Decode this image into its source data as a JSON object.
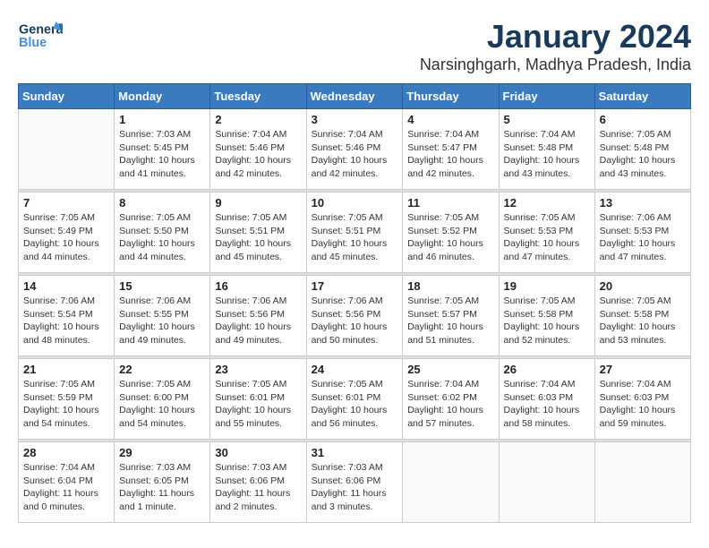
{
  "header": {
    "logo_line1": "General",
    "logo_line2": "Blue",
    "title": "January 2024",
    "subtitle": "Narsinghgarh, Madhya Pradesh, India"
  },
  "days_of_week": [
    "Sunday",
    "Monday",
    "Tuesday",
    "Wednesday",
    "Thursday",
    "Friday",
    "Saturday"
  ],
  "weeks": [
    [
      {
        "day": "",
        "sunrise": "",
        "sunset": "",
        "daylight": ""
      },
      {
        "day": "1",
        "sunrise": "Sunrise: 7:03 AM",
        "sunset": "Sunset: 5:45 PM",
        "daylight": "Daylight: 10 hours and 41 minutes."
      },
      {
        "day": "2",
        "sunrise": "Sunrise: 7:04 AM",
        "sunset": "Sunset: 5:46 PM",
        "daylight": "Daylight: 10 hours and 42 minutes."
      },
      {
        "day": "3",
        "sunrise": "Sunrise: 7:04 AM",
        "sunset": "Sunset: 5:46 PM",
        "daylight": "Daylight: 10 hours and 42 minutes."
      },
      {
        "day": "4",
        "sunrise": "Sunrise: 7:04 AM",
        "sunset": "Sunset: 5:47 PM",
        "daylight": "Daylight: 10 hours and 42 minutes."
      },
      {
        "day": "5",
        "sunrise": "Sunrise: 7:04 AM",
        "sunset": "Sunset: 5:48 PM",
        "daylight": "Daylight: 10 hours and 43 minutes."
      },
      {
        "day": "6",
        "sunrise": "Sunrise: 7:05 AM",
        "sunset": "Sunset: 5:48 PM",
        "daylight": "Daylight: 10 hours and 43 minutes."
      }
    ],
    [
      {
        "day": "7",
        "sunrise": "Sunrise: 7:05 AM",
        "sunset": "Sunset: 5:49 PM",
        "daylight": "Daylight: 10 hours and 44 minutes."
      },
      {
        "day": "8",
        "sunrise": "Sunrise: 7:05 AM",
        "sunset": "Sunset: 5:50 PM",
        "daylight": "Daylight: 10 hours and 44 minutes."
      },
      {
        "day": "9",
        "sunrise": "Sunrise: 7:05 AM",
        "sunset": "Sunset: 5:51 PM",
        "daylight": "Daylight: 10 hours and 45 minutes."
      },
      {
        "day": "10",
        "sunrise": "Sunrise: 7:05 AM",
        "sunset": "Sunset: 5:51 PM",
        "daylight": "Daylight: 10 hours and 45 minutes."
      },
      {
        "day": "11",
        "sunrise": "Sunrise: 7:05 AM",
        "sunset": "Sunset: 5:52 PM",
        "daylight": "Daylight: 10 hours and 46 minutes."
      },
      {
        "day": "12",
        "sunrise": "Sunrise: 7:05 AM",
        "sunset": "Sunset: 5:53 PM",
        "daylight": "Daylight: 10 hours and 47 minutes."
      },
      {
        "day": "13",
        "sunrise": "Sunrise: 7:06 AM",
        "sunset": "Sunset: 5:53 PM",
        "daylight": "Daylight: 10 hours and 47 minutes."
      }
    ],
    [
      {
        "day": "14",
        "sunrise": "Sunrise: 7:06 AM",
        "sunset": "Sunset: 5:54 PM",
        "daylight": "Daylight: 10 hours and 48 minutes."
      },
      {
        "day": "15",
        "sunrise": "Sunrise: 7:06 AM",
        "sunset": "Sunset: 5:55 PM",
        "daylight": "Daylight: 10 hours and 49 minutes."
      },
      {
        "day": "16",
        "sunrise": "Sunrise: 7:06 AM",
        "sunset": "Sunset: 5:56 PM",
        "daylight": "Daylight: 10 hours and 49 minutes."
      },
      {
        "day": "17",
        "sunrise": "Sunrise: 7:06 AM",
        "sunset": "Sunset: 5:56 PM",
        "daylight": "Daylight: 10 hours and 50 minutes."
      },
      {
        "day": "18",
        "sunrise": "Sunrise: 7:05 AM",
        "sunset": "Sunset: 5:57 PM",
        "daylight": "Daylight: 10 hours and 51 minutes."
      },
      {
        "day": "19",
        "sunrise": "Sunrise: 7:05 AM",
        "sunset": "Sunset: 5:58 PM",
        "daylight": "Daylight: 10 hours and 52 minutes."
      },
      {
        "day": "20",
        "sunrise": "Sunrise: 7:05 AM",
        "sunset": "Sunset: 5:58 PM",
        "daylight": "Daylight: 10 hours and 53 minutes."
      }
    ],
    [
      {
        "day": "21",
        "sunrise": "Sunrise: 7:05 AM",
        "sunset": "Sunset: 5:59 PM",
        "daylight": "Daylight: 10 hours and 54 minutes."
      },
      {
        "day": "22",
        "sunrise": "Sunrise: 7:05 AM",
        "sunset": "Sunset: 6:00 PM",
        "daylight": "Daylight: 10 hours and 54 minutes."
      },
      {
        "day": "23",
        "sunrise": "Sunrise: 7:05 AM",
        "sunset": "Sunset: 6:01 PM",
        "daylight": "Daylight: 10 hours and 55 minutes."
      },
      {
        "day": "24",
        "sunrise": "Sunrise: 7:05 AM",
        "sunset": "Sunset: 6:01 PM",
        "daylight": "Daylight: 10 hours and 56 minutes."
      },
      {
        "day": "25",
        "sunrise": "Sunrise: 7:04 AM",
        "sunset": "Sunset: 6:02 PM",
        "daylight": "Daylight: 10 hours and 57 minutes."
      },
      {
        "day": "26",
        "sunrise": "Sunrise: 7:04 AM",
        "sunset": "Sunset: 6:03 PM",
        "daylight": "Daylight: 10 hours and 58 minutes."
      },
      {
        "day": "27",
        "sunrise": "Sunrise: 7:04 AM",
        "sunset": "Sunset: 6:03 PM",
        "daylight": "Daylight: 10 hours and 59 minutes."
      }
    ],
    [
      {
        "day": "28",
        "sunrise": "Sunrise: 7:04 AM",
        "sunset": "Sunset: 6:04 PM",
        "daylight": "Daylight: 11 hours and 0 minutes."
      },
      {
        "day": "29",
        "sunrise": "Sunrise: 7:03 AM",
        "sunset": "Sunset: 6:05 PM",
        "daylight": "Daylight: 11 hours and 1 minute."
      },
      {
        "day": "30",
        "sunrise": "Sunrise: 7:03 AM",
        "sunset": "Sunset: 6:06 PM",
        "daylight": "Daylight: 11 hours and 2 minutes."
      },
      {
        "day": "31",
        "sunrise": "Sunrise: 7:03 AM",
        "sunset": "Sunset: 6:06 PM",
        "daylight": "Daylight: 11 hours and 3 minutes."
      },
      {
        "day": "",
        "sunrise": "",
        "sunset": "",
        "daylight": ""
      },
      {
        "day": "",
        "sunrise": "",
        "sunset": "",
        "daylight": ""
      },
      {
        "day": "",
        "sunrise": "",
        "sunset": "",
        "daylight": ""
      }
    ]
  ]
}
